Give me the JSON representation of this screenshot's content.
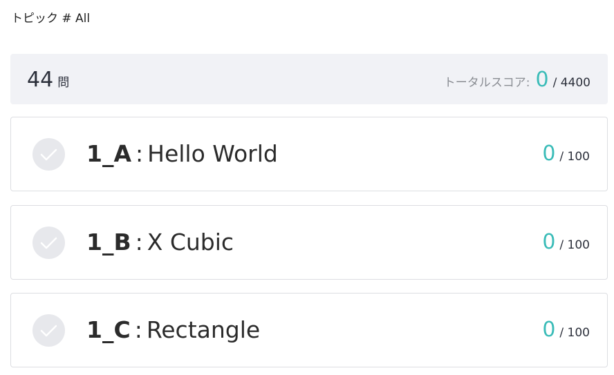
{
  "topic": {
    "label": "トピック # All"
  },
  "summary": {
    "count": "44",
    "count_unit": "問",
    "total_label": "トータルスコア:",
    "total_score": "0",
    "total_max": "/ 4400"
  },
  "problems": [
    {
      "id": "1_A",
      "separator": ":",
      "title": "Hello World",
      "score": "0",
      "max": "/ 100",
      "icon": "check-icon"
    },
    {
      "id": "1_B",
      "separator": ":",
      "title": "X Cubic",
      "score": "0",
      "max": "/ 100",
      "icon": "check-icon"
    },
    {
      "id": "1_C",
      "separator": ":",
      "title": "Rectangle",
      "score": "0",
      "max": "/ 100",
      "icon": "check-icon"
    }
  ],
  "colors": {
    "accent": "#3bbcb8",
    "summary_bg": "#f1f2f6",
    "check_bg": "#e7e8ec"
  }
}
